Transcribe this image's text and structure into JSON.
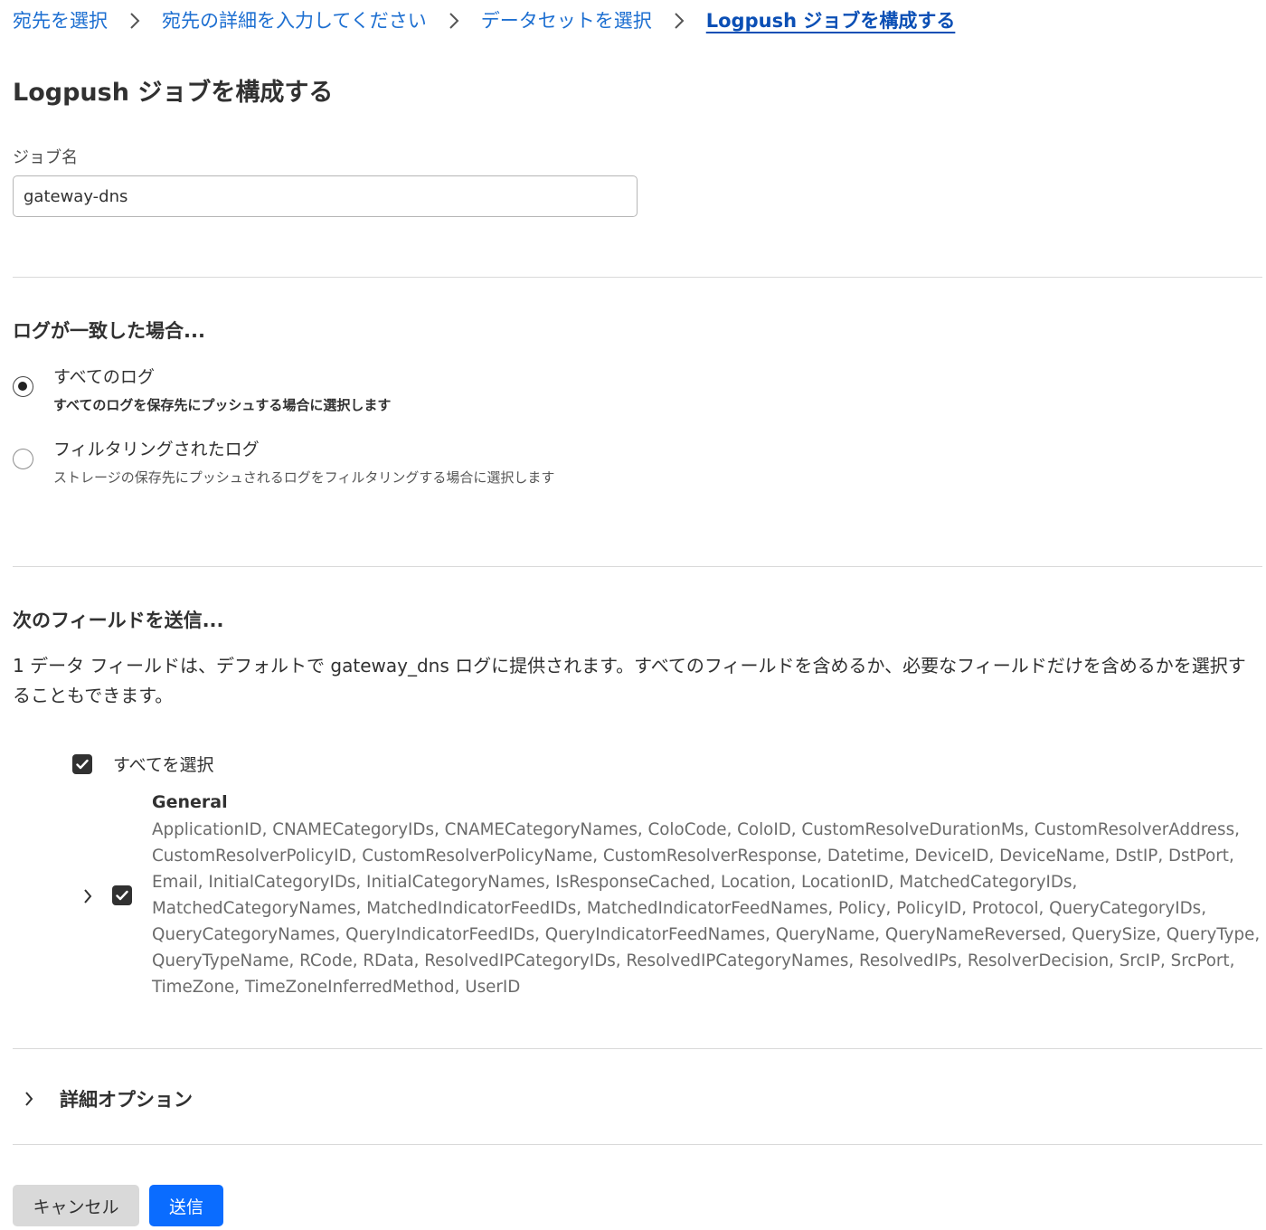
{
  "breadcrumb": {
    "steps": [
      "宛先を選択",
      "宛先の詳細を入力してください",
      "データセットを選択",
      "Logpush ジョブを構成する"
    ]
  },
  "page_title": "Logpush ジョブを構成する",
  "job_name": {
    "label": "ジョブ名",
    "value": "gateway-dns"
  },
  "log_match": {
    "heading": "ログが一致した場合...",
    "options": [
      {
        "label": "すべてのログ",
        "description": "すべてのログを保存先にプッシュする場合に選択します",
        "selected": true
      },
      {
        "label": "フィルタリングされたログ",
        "description": "ストレージの保存先にプッシュされるログをフィルタリングする場合に選択します",
        "selected": false
      }
    ]
  },
  "fields": {
    "heading": "次のフィールドを送信...",
    "description": "1 データ フィールドは、デフォルトで gateway_dns ログに提供されます。すべてのフィールドを含めるか、必要なフィールドだけを含めるかを選択することもできます。",
    "select_all_label": "すべてを選択",
    "select_all_checked": true,
    "group": {
      "title": "General",
      "checked": true,
      "fields": "ApplicationID, CNAMECategoryIDs, CNAMECategoryNames, ColoCode, ColoID, CustomResolveDurationMs, CustomResolverAddress, CustomResolverPolicyID, CustomResolverPolicyName, CustomResolverResponse, Datetime, DeviceID, DeviceName, DstIP, DstPort, Email, InitialCategoryIDs, InitialCategoryNames, IsResponseCached, Location, LocationID, MatchedCategoryIDs, MatchedCategoryNames, MatchedIndicatorFeedIDs, MatchedIndicatorFeedNames, Policy, PolicyID, Protocol, QueryCategoryIDs, QueryCategoryNames, QueryIndicatorFeedIDs, QueryIndicatorFeedNames, QueryName, QueryNameReversed, QuerySize, QueryType, QueryTypeName, RCode, RData, ResolvedIPCategoryIDs, ResolvedIPCategoryNames, ResolvedIPs, ResolverDecision, SrcIP, SrcPort, TimeZone, TimeZoneInferredMethod, UserID"
    }
  },
  "advanced_options_label": "詳細オプション",
  "buttons": {
    "cancel": "キャンセル",
    "submit": "送信"
  },
  "colors": {
    "link": "#1d6fd1",
    "primary_button": "#0a6cff",
    "secondary_button": "#d9d9d9",
    "checkbox": "#313131"
  }
}
